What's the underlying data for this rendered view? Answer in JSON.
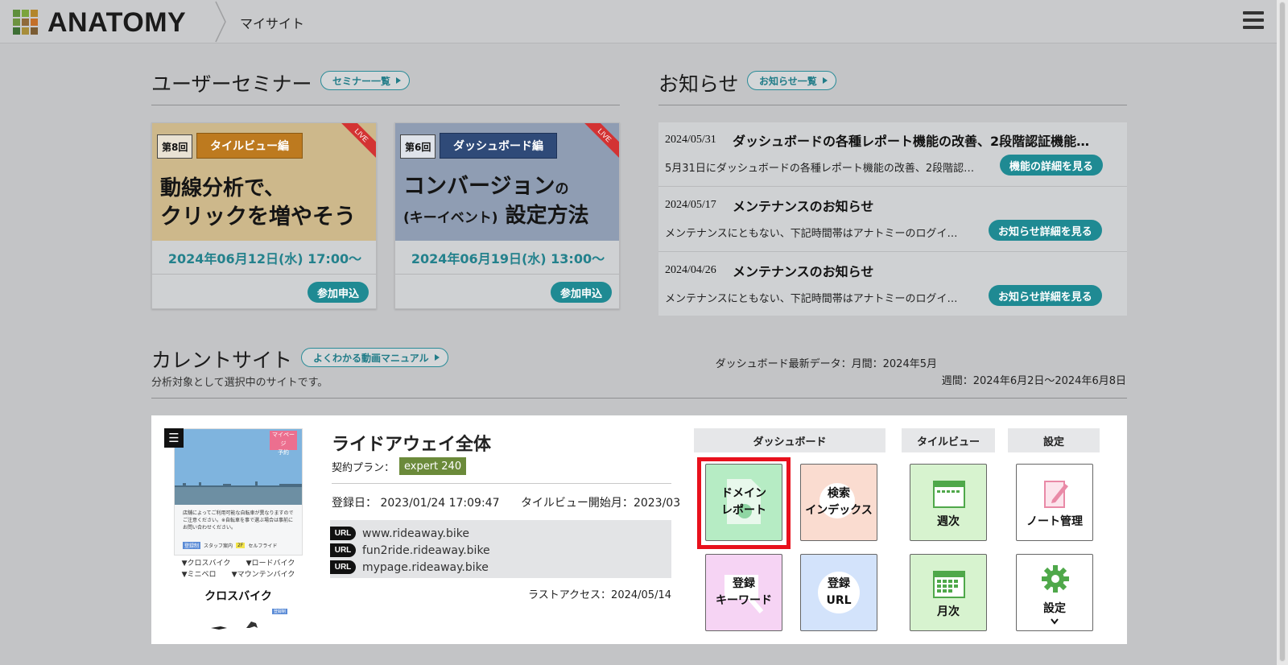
{
  "header": {
    "logo_text": "ANATOMY",
    "breadcrumb": "マイサイト",
    "logo_colors": [
      "#5e8f3c",
      "#7ba43c",
      "#b3862c",
      "#6d9340",
      "#8f6a3a",
      "#c46f29",
      "#3e6f35",
      "#a78d3a",
      "#7b5c33"
    ]
  },
  "seminar": {
    "title": "ユーザーセミナー",
    "list_button": "セミナー一覧",
    "cards": [
      {
        "round": "第8回",
        "category": "タイルビュー編",
        "live": "LIVE",
        "headline_1": "動線分析で、",
        "headline_2": "クリックを増やそう",
        "date": "2024年06月12日(水) 17:00〜",
        "button": "参加申込"
      },
      {
        "round": "第6回",
        "category": "ダッシュボード編",
        "live": "LIVE",
        "headline_1": "コンバージョン",
        "headline_1_small": "の",
        "headline_2_small": "(キーイベント)",
        "headline_2": "設定方法",
        "date": "2024年06月19日(水) 13:00〜",
        "button": "参加申込"
      }
    ]
  },
  "news": {
    "title": "お知らせ",
    "list_button": "お知らせ一覧",
    "items": [
      {
        "date": "2024/05/31",
        "title": "ダッシュボードの各種レポート機能の改善、2段階認証機能…",
        "body": "5月31日にダッシュボードの各種レポート機能の改善、2段階認…",
        "button": "機能の詳細を見る"
      },
      {
        "date": "2024/05/17",
        "title": "メンテナンスのお知らせ",
        "body": "メンテナンスにともない、下記時間帯はアナトミーのログイ…",
        "button": "お知らせ詳細を見る"
      },
      {
        "date": "2024/04/26",
        "title": "メンテナンスのお知らせ",
        "body": "メンテナンスにともない、下記時間帯はアナトミーのログイ…",
        "button": "お知らせ詳細を見る"
      }
    ]
  },
  "current_site": {
    "title": "カレントサイト",
    "manual_button": "よくわかる動画マニュアル",
    "subtitle": "分析対象として選択中のサイトです。",
    "dashboard_monthly": "ダッシュボード最新データ：月間：2024年5月",
    "dashboard_weekly": "週間：2024年6月2日〜2024年6月8日",
    "thumb": {
      "tag_1": "マイページ",
      "tag_2": "予約",
      "notice": "店舗によってご利用可能な自転車が異なりますのでご注意ください。※自転車を事で選ぶ場合は事前にお問い合わせください。",
      "chip_1": "登録制",
      "chip_1_text": "スタッフ案内",
      "chip_2": "2F",
      "chip_2_text": "セルフライド",
      "link_1": "▼クロスバイク",
      "link_2": "▼ロードバイク",
      "link_3": "▼ミニベロ",
      "link_4": "▼マウンテンバイク",
      "category": "クロスバイク",
      "mini_chip": "登録制"
    },
    "site_name": "ライドアウェイ全体",
    "plan_label": "契約プラン：",
    "plan": "expert 240",
    "registered_label": "登録日：",
    "registered": "2023/01/24 17:09:47",
    "tileview_start_label": "タイルビュー開始月：",
    "tileview_start": "2023/03",
    "url_badge": "URL",
    "urls": [
      "www.rideaway.bike",
      "fun2ride.rideaway.bike",
      "mypage.rideaway.bike"
    ],
    "last_access": "ラストアクセス：2024/05/14"
  },
  "tiles": {
    "dashboard_header": "ダッシュボード",
    "tileview_header": "タイルビュー",
    "settings_header": "設定",
    "domain_report_1": "ドメイン",
    "domain_report_2": "レポート",
    "search_index_1": "検索",
    "search_index_2": "インデックス",
    "reg_keyword_1": "登録",
    "reg_keyword_2": "キーワード",
    "reg_url_1": "登録",
    "reg_url_2": "URL",
    "weekly": "週次",
    "monthly": "月次",
    "note": "ノート管理",
    "settings": "設定"
  },
  "colors": {
    "teal": "#1f8a93",
    "tile_domain": "#b6ecc4",
    "tile_search": "#fadcd0",
    "tile_keyword": "#f6d4f4",
    "tile_url": "#d3e3fb",
    "tile_tileview": "#d7f3cf",
    "highlight": "#e8101c"
  }
}
